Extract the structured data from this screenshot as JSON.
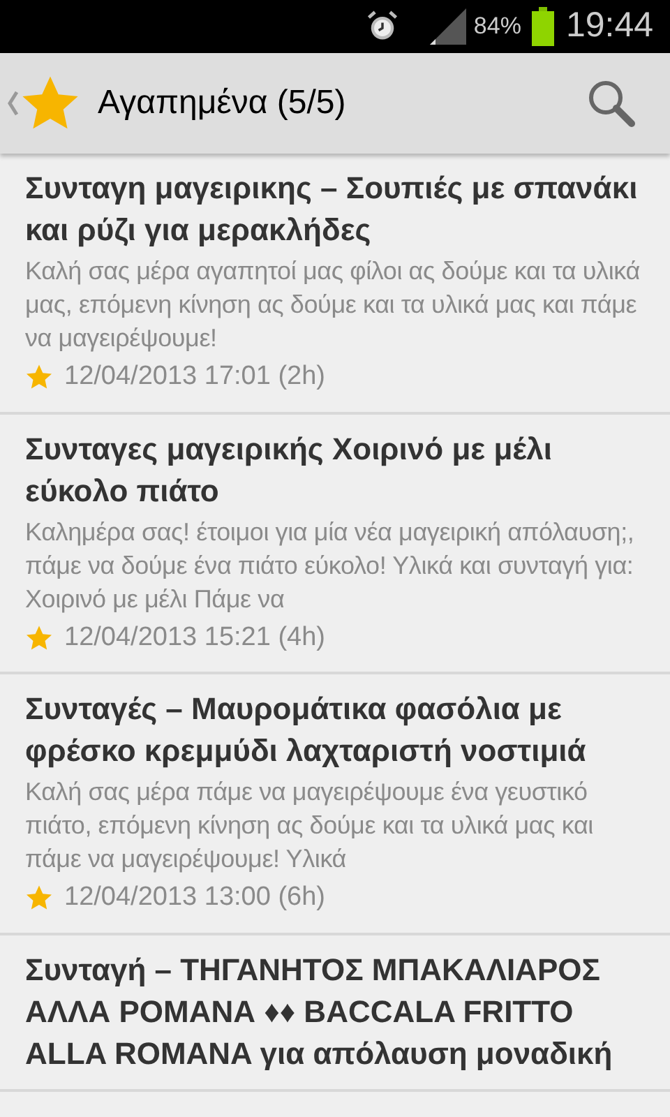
{
  "status_bar": {
    "battery": "84%",
    "time": "19:44"
  },
  "action_bar": {
    "title": "Αγαπημένα (5/5)"
  },
  "items": [
    {
      "title": "Συνταγη μαγειρικης – Σουπιές με σπανάκι και ρύζι για μερακλήδες",
      "snippet": "Καλή σας μέρα αγαπητοί μας φίλοι ας δούμε και τα υλικά μας, επόμενη κίνηση ας δούμε και τα υλικά μας και πάμε να μαγειρέψουμε!",
      "date": "12/04/2013 17:01 (2h)"
    },
    {
      "title": "Συνταγες μαγειρικής Χοιρινό με μέλι εύκολο πιάτο",
      "snippet": "Καλημέρα σας! έτοιμοι για μία νέα μαγειρική απόλαυση;, πάμε να δούμε ένα πιάτο εύκολο! Υλικά και συνταγή για: Χοιρινό με μέλι Πάμε να",
      "date": "12/04/2013 15:21 (4h)"
    },
    {
      "title": "Συνταγές – Μαυρομάτικα φασόλια με φρέσκο κρεμμύδι λαχταριστή νοστιμιά",
      "snippet": "Καλή σας μέρα πάμε να μαγειρέψουμε ένα γευστικό πιάτο, επόμενη κίνηση ας δούμε και τα υλικά μας και πάμε να μαγειρέψουμε! Υλικά",
      "date": "12/04/2013 13:00 (6h)"
    },
    {
      "title": "Συνταγή – ΤΗΓΑΝΗΤΟΣ ΜΠΑΚΑΛΙΑΡΟΣ ΑΛΛΑ ΡΟΜΑΝΑ ♦♦ BACCALA FRITTO ALLA ROMANA για απόλαυση μοναδική"
    }
  ]
}
